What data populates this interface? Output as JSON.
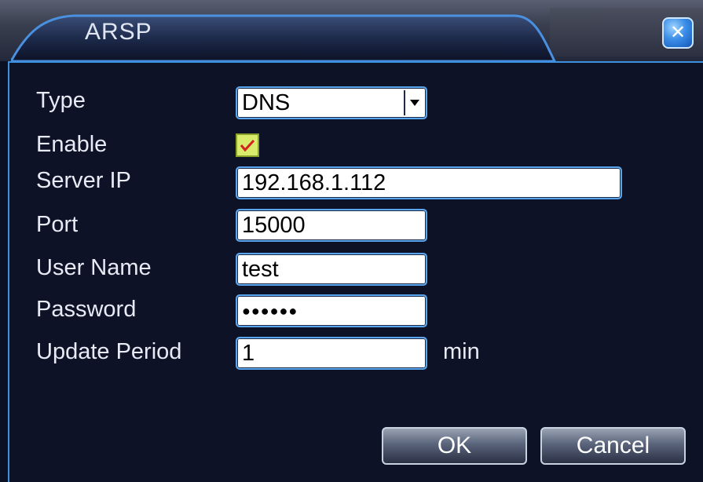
{
  "window": {
    "title": "ARSP",
    "close_icon": "close-icon"
  },
  "form": {
    "type_label": "Type",
    "type_value": "DNS",
    "enable_label": "Enable",
    "enable_checked": true,
    "server_ip_label": "Server IP",
    "server_ip_value": "192.168.1.112",
    "port_label": "Port",
    "port_value": "15000",
    "username_label": "User Name",
    "username_value": "test",
    "password_label": "Password",
    "password_value": "●●●●●●",
    "update_period_label": "Update Period",
    "update_period_value": "1",
    "update_period_unit": "min"
  },
  "buttons": {
    "ok_label": "OK",
    "cancel_label": "Cancel"
  },
  "colors": {
    "panel_bg": "#0d1226",
    "accent_border": "#3d8fe0",
    "checkbox_fill": "#d8eb6a",
    "checkmark": "#d42020"
  }
}
